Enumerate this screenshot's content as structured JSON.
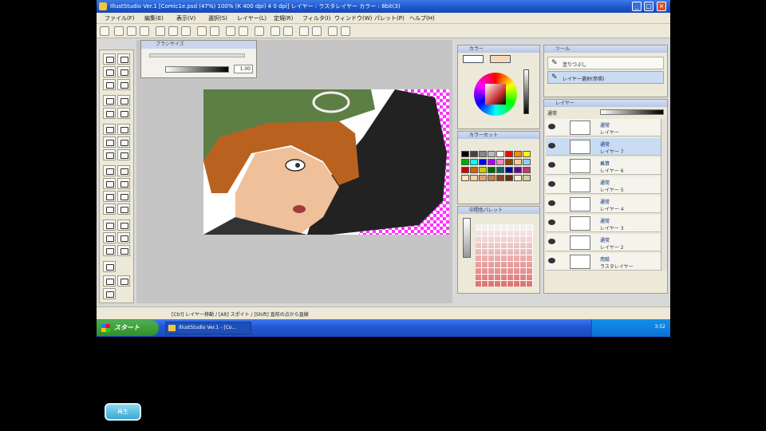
{
  "window": {
    "title": "IllustStudio Ver.1  [Comic1e.psd (47%) 100% (K 400 dpi) 4 0 dpi]  レイヤー : ラスタレイヤー  カラー : 8bit(3)"
  },
  "menu": {
    "items": [
      "ファイル(F)",
      "編集(E)",
      "表示(V)",
      "選択(S)",
      "レイヤー(L)",
      "定規(R)",
      "フィルタ(I)",
      "ウィンドウ(W)",
      "パレット(P)",
      "ヘルプ(H)"
    ]
  },
  "brush_popup": {
    "title": "ブラシサイズ",
    "value": "1.00"
  },
  "color_panel": {
    "title": "カラー"
  },
  "colorset_panel": {
    "title": "カラーセット",
    "swatch_colors": [
      "#000000",
      "#444444",
      "#888888",
      "#bbbbbb",
      "#ffffff",
      "#ff0000",
      "#ff8800",
      "#ffff00",
      "#00aa00",
      "#00ffff",
      "#0000ff",
      "#aa00ff",
      "#ff88cc",
      "#884400",
      "#ffcc99",
      "#99ccff",
      "#cc0000",
      "#cc6600",
      "#cccc00",
      "#006600",
      "#006666",
      "#000099",
      "#660099",
      "#cc3366",
      "#ffe0c0",
      "#ffd0a0",
      "#e0a070",
      "#c08050",
      "#904020",
      "#603010",
      "#f0f0d0",
      "#d0d0a0"
    ]
  },
  "mixer_panel": {
    "title": "中間色パレット"
  },
  "nav_panel": {
    "title": "ツール",
    "items": [
      {
        "label": "塗りつぶし"
      },
      {
        "label": "レイヤー選択(参照)"
      }
    ]
  },
  "layer_panel": {
    "title": "レイヤー",
    "blend_label": "通常",
    "layers": [
      {
        "name": "通常",
        "sub": "レイヤー"
      },
      {
        "name": "通常",
        "sub": "レイヤー 7"
      },
      {
        "name": "乗算",
        "sub": "レイヤー 6"
      },
      {
        "name": "通常",
        "sub": "レイヤー 5"
      },
      {
        "name": "通常",
        "sub": "レイヤー 4"
      },
      {
        "name": "通常",
        "sub": "レイヤー 3"
      },
      {
        "name": "通常",
        "sub": "レイヤー 2"
      },
      {
        "name": "用紙",
        "sub": "ラスタレイヤー"
      }
    ]
  },
  "status": {
    "text": "[Ctrl] レイヤー移動 / [Alt] スポイト / [Shift] 直前の点から直線"
  },
  "taskbar": {
    "start_label": "スタート",
    "task_label": "IllustStudio Ver.1 - [Co...",
    "clock": "3:52"
  },
  "badge": {
    "label": "再生"
  }
}
